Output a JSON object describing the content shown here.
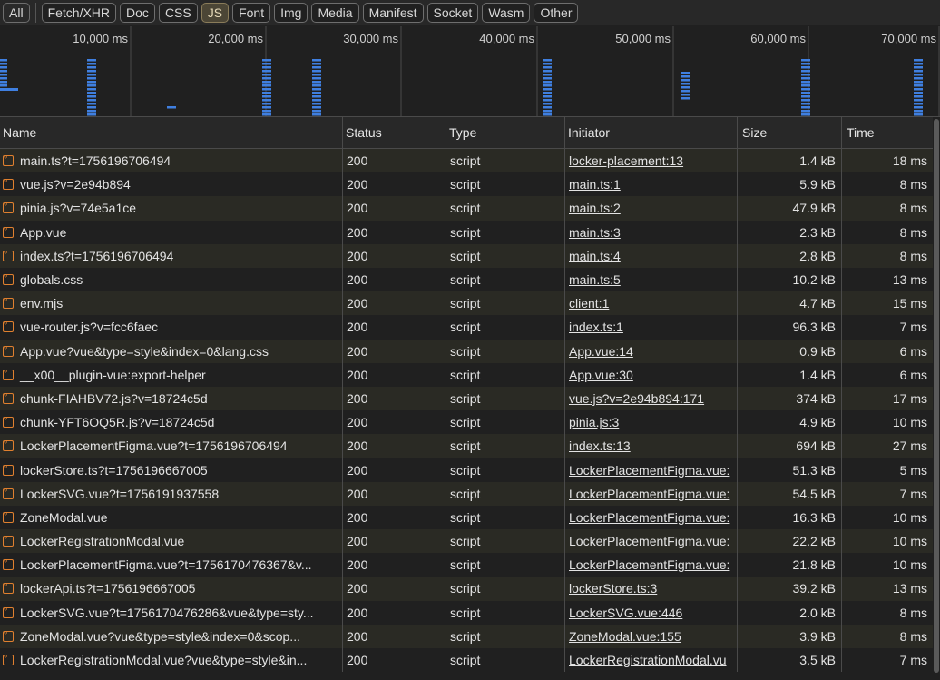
{
  "filters": [
    "All",
    "Fetch/XHR",
    "Doc",
    "CSS",
    "JS",
    "Font",
    "Img",
    "Media",
    "Manifest",
    "Socket",
    "Wasm",
    "Other"
  ],
  "active_filter": "JS",
  "overview": {
    "ticks": [
      "10,000 ms",
      "20,000 ms",
      "30,000 ms",
      "40,000 ms",
      "50,000 ms",
      "60,000 ms",
      "70,000 ms"
    ],
    "bar_color": "#3f7fe0"
  },
  "columns": {
    "name": "Name",
    "status": "Status",
    "type": "Type",
    "initiator": "Initiator",
    "size": "Size",
    "time": "Time"
  },
  "rows": [
    {
      "name": "main.ts?t=1756196706494",
      "status": "200",
      "type": "script",
      "initiator": "locker-placement:13",
      "size": "1.4 kB",
      "time": "18 ms"
    },
    {
      "name": "vue.js?v=2e94b894",
      "status": "200",
      "type": "script",
      "initiator": "main.ts:1",
      "size": "5.9 kB",
      "time": "8 ms"
    },
    {
      "name": "pinia.js?v=74e5a1ce",
      "status": "200",
      "type": "script",
      "initiator": "main.ts:2",
      "size": "47.9 kB",
      "time": "8 ms"
    },
    {
      "name": "App.vue",
      "status": "200",
      "type": "script",
      "initiator": "main.ts:3",
      "size": "2.3 kB",
      "time": "8 ms"
    },
    {
      "name": "index.ts?t=1756196706494",
      "status": "200",
      "type": "script",
      "initiator": "main.ts:4",
      "size": "2.8 kB",
      "time": "8 ms"
    },
    {
      "name": "globals.css",
      "status": "200",
      "type": "script",
      "initiator": "main.ts:5",
      "size": "10.2 kB",
      "time": "13 ms"
    },
    {
      "name": "env.mjs",
      "status": "200",
      "type": "script",
      "initiator": "client:1",
      "size": "4.7 kB",
      "time": "15 ms"
    },
    {
      "name": "vue-router.js?v=fcc6faec",
      "status": "200",
      "type": "script",
      "initiator": "index.ts:1",
      "size": "96.3 kB",
      "time": "7 ms"
    },
    {
      "name": "App.vue?vue&type=style&index=0&lang.css",
      "status": "200",
      "type": "script",
      "initiator": "App.vue:14",
      "size": "0.9 kB",
      "time": "6 ms"
    },
    {
      "name": "__x00__plugin-vue:export-helper",
      "status": "200",
      "type": "script",
      "initiator": "App.vue:30",
      "size": "1.4 kB",
      "time": "6 ms"
    },
    {
      "name": "chunk-FIAHBV72.js?v=18724c5d",
      "status": "200",
      "type": "script",
      "initiator": "vue.js?v=2e94b894:171",
      "size": "374 kB",
      "time": "17 ms"
    },
    {
      "name": "chunk-YFT6OQ5R.js?v=18724c5d",
      "status": "200",
      "type": "script",
      "initiator": "pinia.js:3",
      "size": "4.9 kB",
      "time": "10 ms"
    },
    {
      "name": "LockerPlacementFigma.vue?t=1756196706494",
      "status": "200",
      "type": "script",
      "initiator": "index.ts:13",
      "size": "694 kB",
      "time": "27 ms"
    },
    {
      "name": "lockerStore.ts?t=1756196667005",
      "status": "200",
      "type": "script",
      "initiator": "LockerPlacementFigma.vue:",
      "size": "51.3 kB",
      "time": "5 ms"
    },
    {
      "name": "LockerSVG.vue?t=1756191937558",
      "status": "200",
      "type": "script",
      "initiator": "LockerPlacementFigma.vue:",
      "size": "54.5 kB",
      "time": "7 ms"
    },
    {
      "name": "ZoneModal.vue",
      "status": "200",
      "type": "script",
      "initiator": "LockerPlacementFigma.vue:",
      "size": "16.3 kB",
      "time": "10 ms"
    },
    {
      "name": "LockerRegistrationModal.vue",
      "status": "200",
      "type": "script",
      "initiator": "LockerPlacementFigma.vue:",
      "size": "22.2 kB",
      "time": "10 ms"
    },
    {
      "name": "LockerPlacementFigma.vue?t=1756170476367&v...",
      "status": "200",
      "type": "script",
      "initiator": "LockerPlacementFigma.vue:",
      "size": "21.8 kB",
      "time": "10 ms"
    },
    {
      "name": "lockerApi.ts?t=1756196667005",
      "status": "200",
      "type": "script",
      "initiator": "lockerStore.ts:3",
      "size": "39.2 kB",
      "time": "13 ms"
    },
    {
      "name": "LockerSVG.vue?t=1756170476286&vue&type=sty...",
      "status": "200",
      "type": "script",
      "initiator": "LockerSVG.vue:446",
      "size": "2.0 kB",
      "time": "8 ms"
    },
    {
      "name": "ZoneModal.vue?vue&type=style&index=0&scop...",
      "status": "200",
      "type": "script",
      "initiator": "ZoneModal.vue:155",
      "size": "3.9 kB",
      "time": "8 ms"
    },
    {
      "name": "LockerRegistrationModal.vue?vue&type=style&in...",
      "status": "200",
      "type": "script",
      "initiator": "LockerRegistrationModal.vu",
      "size": "3.5 kB",
      "time": "7 ms"
    }
  ]
}
